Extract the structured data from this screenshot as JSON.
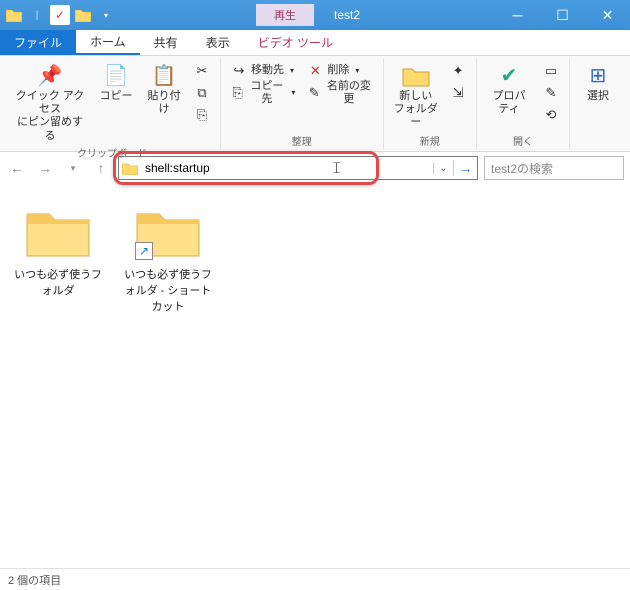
{
  "titlebar": {
    "contextual_tab": "再生",
    "title": "test2"
  },
  "tabs": {
    "file": "ファイル",
    "home": "ホーム",
    "share": "共有",
    "view": "表示",
    "video_tools": "ビデオ ツール"
  },
  "ribbon": {
    "quick_access": "クイック アクセス\nにピン留めする",
    "copy": "コピー",
    "paste": "貼り付け",
    "group_clipboard": "クリップボード",
    "move_to": "移動先",
    "copy_to": "コピー先",
    "delete": "削除",
    "rename": "名前の変更",
    "group_organize": "整理",
    "new_folder": "新しい\nフォルダー",
    "group_new": "新規",
    "properties": "プロパティ",
    "group_open": "開く",
    "select": "選択"
  },
  "address": {
    "value": "shell:startup",
    "search_placeholder": "test2の検索"
  },
  "items": [
    {
      "name": "いつも必ず使うフォルダ",
      "shortcut": false
    },
    {
      "name": "いつも必ず使うフォルダ - ショートカット",
      "shortcut": true
    }
  ],
  "status": {
    "text": "2 個の項目"
  }
}
